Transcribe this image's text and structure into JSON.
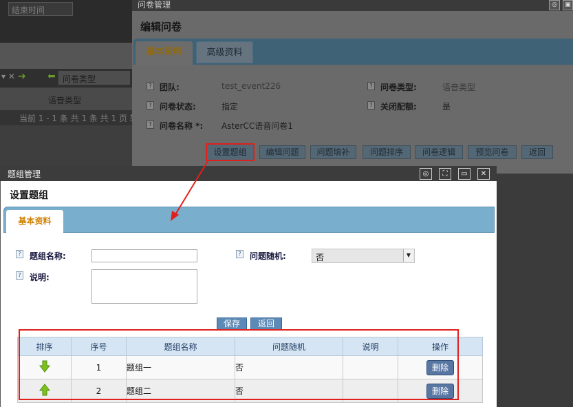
{
  "background_app": {
    "search_placeholder": "结束时间",
    "toolbar_icons": "▾ ✕",
    "filter_select_value": "问卷类型",
    "row_value": "语音类型",
    "pager_text": "当前 1 - 1 条 共 1 条 共 1 页 转"
  },
  "survey_window": {
    "title": "问卷管理",
    "heading": "编辑问卷",
    "tabs": [
      {
        "label": "基本资料",
        "active": true
      },
      {
        "label": "高级资料",
        "active": false
      }
    ],
    "fields": {
      "team_label": "团队:",
      "team_value": "test_event226",
      "type_label": "问卷类型:",
      "type_value": "语音类型",
      "status_label": "问卷状态:",
      "status_value": "指定",
      "close_quota_label": "关闭配额:",
      "close_quota_value": "是",
      "name_label": "问卷名称 *:",
      "name_value": "AsterCC语音问卷1"
    },
    "buttons": [
      "设置题组",
      "编辑问题",
      "问题填补",
      "问题排序",
      "问卷逻辑",
      "预览问卷",
      "返回"
    ]
  },
  "group_window": {
    "title": "题组管理",
    "heading": "设置题组",
    "tab_label": "基本资料",
    "form": {
      "name_label": "题组名称:",
      "name_value": "",
      "random_label": "问题随机:",
      "random_value": "否",
      "desc_label": "说明:",
      "desc_value": ""
    },
    "save_label": "保存",
    "back_label": "返回",
    "table": {
      "headers": [
        "排序",
        "序号",
        "题组名称",
        "问题随机",
        "说明",
        "操作"
      ],
      "rows": [
        {
          "order_arrow": "down",
          "index": "1",
          "name": "题组一",
          "random": "否",
          "desc": "",
          "action": "删除"
        },
        {
          "order_arrow": "up",
          "index": "2",
          "name": "题组二",
          "random": "否",
          "desc": "",
          "action": "删除"
        }
      ]
    }
  },
  "colors": {
    "highlight": "#e0201c",
    "tab_strip": "#7aaecd",
    "active_tab_text": "#d07f00",
    "order_arrow": "#7cc21e"
  }
}
